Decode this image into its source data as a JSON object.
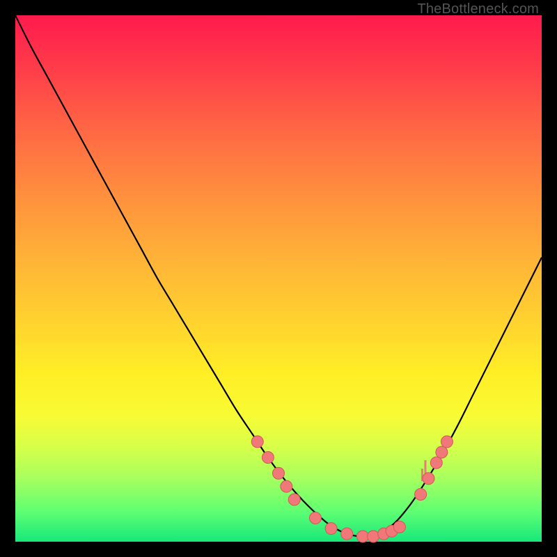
{
  "watermark": "TheBottleneck.com",
  "colors": {
    "curve_stroke": "#000000",
    "marker_fill": "#f07878",
    "marker_stroke": "#d05858"
  },
  "chart_data": {
    "type": "line",
    "title": "",
    "xlabel": "",
    "ylabel": "",
    "xlim": [
      0,
      100
    ],
    "ylim": [
      0,
      100
    ],
    "legend": false,
    "grid": false,
    "series": [
      {
        "name": "bottleneck-curve",
        "x": [
          0,
          3,
          6,
          9,
          12,
          15,
          18,
          21,
          24,
          27,
          30,
          33,
          36,
          39,
          42,
          45,
          48,
          51,
          54,
          57,
          60,
          63,
          66,
          69,
          72,
          75,
          78,
          81,
          84,
          87,
          90,
          93,
          96,
          100
        ],
        "y": [
          100,
          94,
          88.5,
          83,
          77.5,
          72,
          66.5,
          61,
          55.5,
          50,
          45,
          40,
          35,
          30,
          25,
          20.5,
          16,
          12,
          8.5,
          5.5,
          3,
          1.5,
          1,
          1.5,
          3.5,
          7,
          11.5,
          16.5,
          22,
          28,
          34,
          40,
          46,
          54
        ]
      }
    ],
    "markers": [
      {
        "x": 46,
        "y": 19
      },
      {
        "x": 48,
        "y": 16
      },
      {
        "x": 50,
        "y": 13
      },
      {
        "x": 51.5,
        "y": 10.5
      },
      {
        "x": 53,
        "y": 8
      },
      {
        "x": 57,
        "y": 4.5
      },
      {
        "x": 60,
        "y": 2.5
      },
      {
        "x": 63,
        "y": 1.5
      },
      {
        "x": 66,
        "y": 1
      },
      {
        "x": 68,
        "y": 1
      },
      {
        "x": 70,
        "y": 1.5
      },
      {
        "x": 71.5,
        "y": 2
      },
      {
        "x": 73,
        "y": 2.8
      },
      {
        "x": 77,
        "y": 9
      },
      {
        "x": 78.5,
        "y": 12
      },
      {
        "x": 80,
        "y": 15
      },
      {
        "x": 81,
        "y": 17
      },
      {
        "x": 82,
        "y": 19
      }
    ],
    "tick_markers": [
      {
        "x": 77.3,
        "h": 3
      },
      {
        "x": 77.9,
        "h": 5
      }
    ]
  }
}
